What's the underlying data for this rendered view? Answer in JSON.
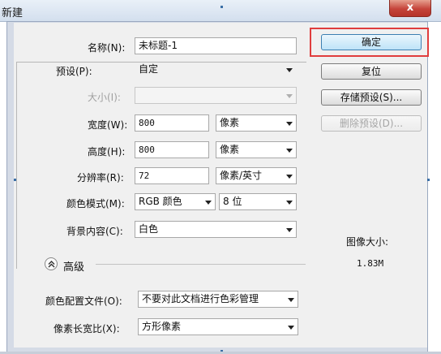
{
  "dialog": {
    "title": "新建",
    "close_label": "x"
  },
  "form": {
    "name": {
      "label": "名称(N):",
      "value": "未标题-1"
    },
    "preset": {
      "label": "预设(P):",
      "value": "自定"
    },
    "size": {
      "label": "大小(I):",
      "value": ""
    },
    "width": {
      "label": "宽度(W):",
      "value": "800",
      "unit": "像素"
    },
    "height": {
      "label": "高度(H):",
      "value": "800",
      "unit": "像素"
    },
    "resolution": {
      "label": "分辨率(R):",
      "value": "72",
      "unit": "像素/英寸"
    },
    "color_mode": {
      "label": "颜色模式(M):",
      "value": "RGB 颜色",
      "bits": "8 位"
    },
    "background": {
      "label": "背景内容(C):",
      "value": "白色"
    },
    "advanced": {
      "label": "高级"
    },
    "color_profile": {
      "label": "颜色配置文件(O):",
      "value": "不要对此文档进行色彩管理"
    },
    "pixel_aspect": {
      "label": "像素长宽比(X):",
      "value": "方形像素"
    }
  },
  "buttons": {
    "ok": "确定",
    "reset": "复位",
    "save_preset": "存储预设(S)...",
    "delete_preset": "删除预设(D)..."
  },
  "image_size": {
    "label": "图像大小:",
    "value": "1.83M"
  },
  "colors": {
    "highlight": "#e03d3d",
    "ok_button": "#bee3f8"
  }
}
